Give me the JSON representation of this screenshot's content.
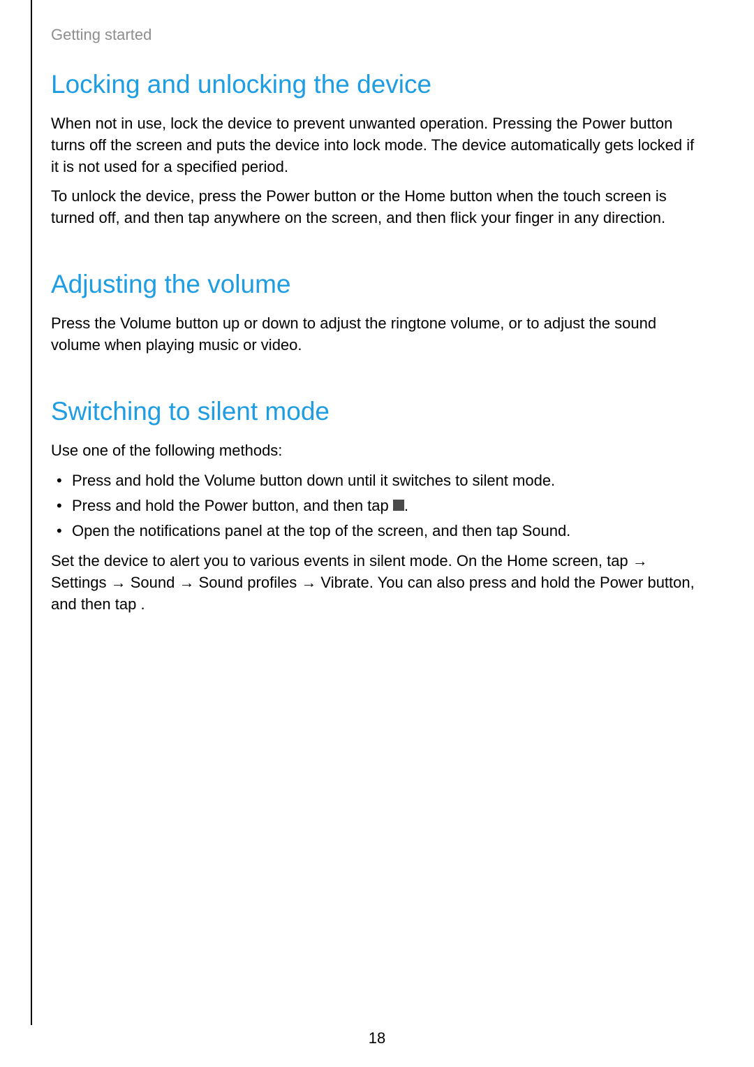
{
  "header": "Getting started",
  "sections": [
    {
      "title": "Locking and unlocking the device",
      "paragraphs": [
        "When not in use, lock the device to prevent unwanted operation. Pressing the Power button turns off the screen and puts the device into lock mode. The device automatically gets locked if it is not used for a specified period.",
        "To unlock the device, press the Power button or the Home button when the touch screen is turned off, and then tap anywhere on the screen, and then flick your finger in any direction."
      ]
    },
    {
      "title": "Adjusting the volume",
      "paragraphs": [
        "Press the Volume button up or down to adjust the ringtone volume, or to adjust the sound volume when playing music or video."
      ]
    },
    {
      "title": "Switching to silent mode",
      "intro": "Use one of the following methods:",
      "bullets": [
        "Press and hold the Volume button down until it switches to silent mode.",
        "Press and hold the Power button, and then tap",
        "Open the notifications panel at the top of the screen, and then tap Sound."
      ],
      "closing": "Set the device to alert you to various events in silent mode. On the Home screen, tap → Settings → Sound → Sound profiles → Vibrate. You can also press and hold the Power button, and then tap   ."
    }
  ],
  "pageNumber": "18"
}
